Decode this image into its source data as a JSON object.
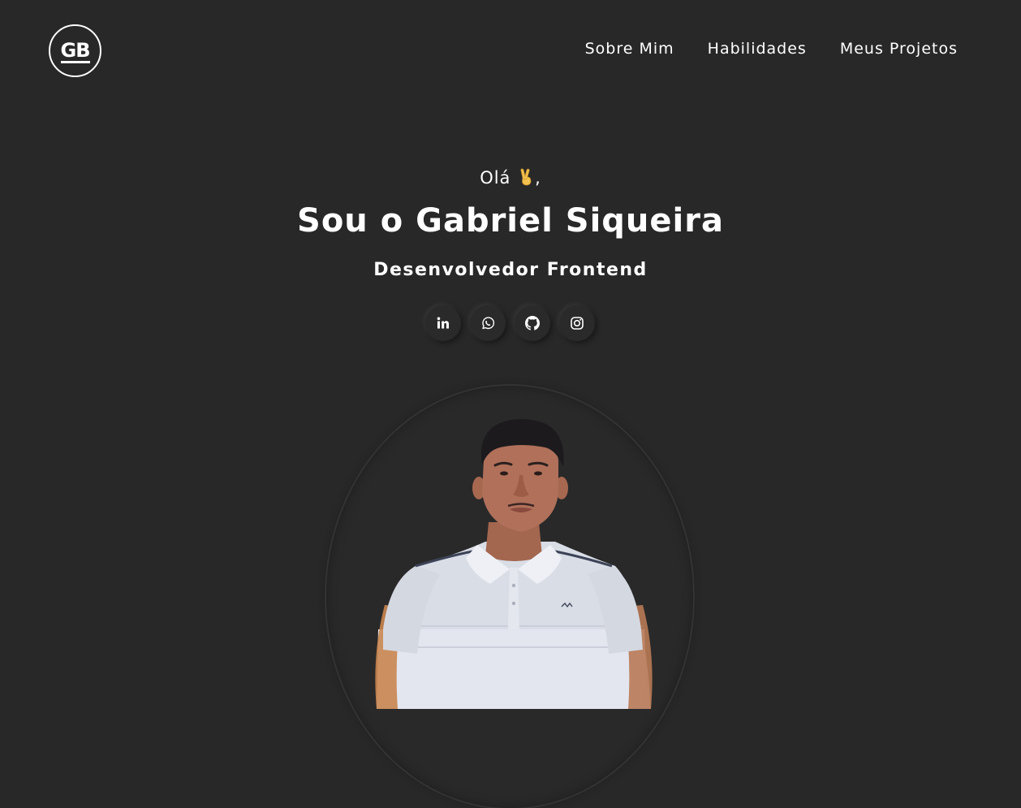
{
  "logo": {
    "text": "GB"
  },
  "nav": {
    "items": [
      {
        "label": "Sobre Mim"
      },
      {
        "label": "Habilidades"
      },
      {
        "label": "Meus Projetos"
      }
    ]
  },
  "hero": {
    "greeting": "Olá",
    "greeting_suffix": ",",
    "greeting_icon": "victory-hand-emoji",
    "name": "Sou o Gabriel Siqueira",
    "role": "Desenvolvedor Frontend"
  },
  "socials": [
    {
      "icon": "linkedin-icon"
    },
    {
      "icon": "whatsapp-icon"
    },
    {
      "icon": "github-icon"
    },
    {
      "icon": "instagram-icon"
    }
  ],
  "colors": {
    "background": "#282828",
    "text": "#ffffff",
    "shirt": "#d9dde6",
    "skin": "#b0705a"
  }
}
